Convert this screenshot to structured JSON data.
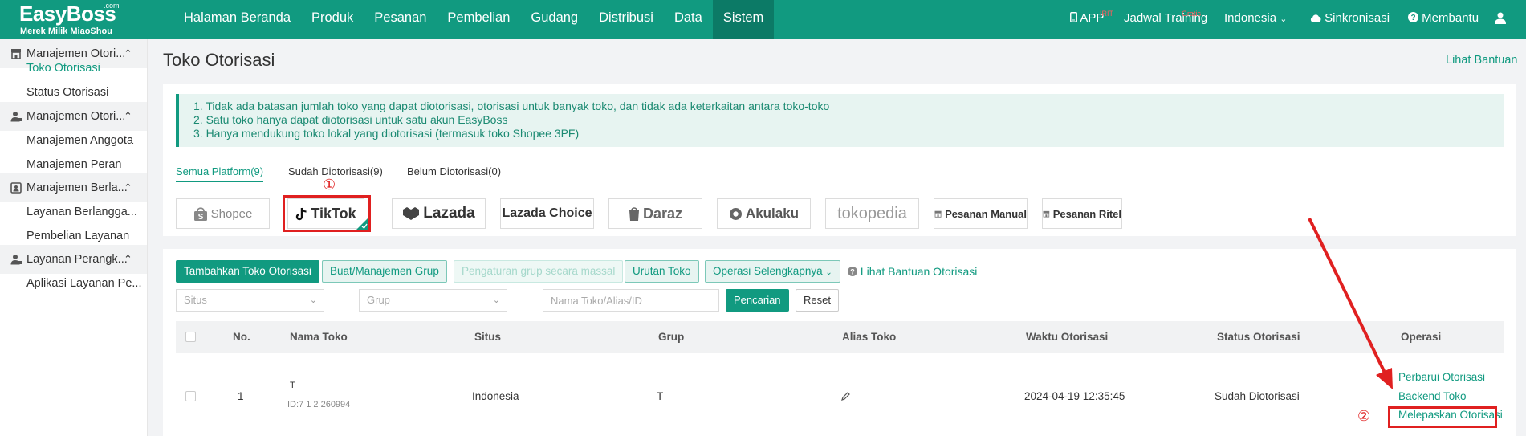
{
  "header": {
    "brand": "EasyBoss",
    "brand_suffix": ".com",
    "tagline": "Merek Milik MiaoShou",
    "nav": [
      "Halaman Beranda",
      "Produk",
      "Pesanan",
      "Pembelian",
      "Gudang",
      "Distribusi",
      "Data",
      "Sistem"
    ],
    "active_nav": "Sistem",
    "app_label": "APP",
    "app_badge": "IRIT",
    "training_label": "Jadwal Training",
    "training_badge": "Gratis",
    "language": "Indonesia",
    "sync_label": "Sinkronisasi",
    "help_label": "Membantu"
  },
  "sidebar": {
    "groups": [
      {
        "label": "Manajemen Otori...",
        "icon": "shop-icon",
        "items": [
          "Toko Otorisasi",
          "Status Otorisasi"
        ]
      },
      {
        "label": "Manajemen Otori...",
        "icon": "user-icon",
        "items": [
          "Manajemen Anggota",
          "Manajemen Peran"
        ]
      },
      {
        "label": "Manajemen Berla...",
        "icon": "contact-card-icon",
        "items": [
          "Layanan Berlangga...",
          "Pembelian Layanan"
        ]
      },
      {
        "label": "Layanan Perangk...",
        "icon": "user-icon",
        "items": [
          "Aplikasi Layanan Pe..."
        ]
      }
    ],
    "active_item": "Toko Otorisasi"
  },
  "page": {
    "title": "Toko Otorisasi",
    "help_link": "Lihat Bantuan",
    "notices": [
      "1. Tidak ada batasan jumlah toko yang dapat diotorisasi, otorisasi untuk banyak toko, dan tidak ada keterkaitan antara toko-toko",
      "2. Satu toko hanya dapat diotorisasi untuk satu akun EasyBoss",
      "3. Hanya mendukung toko lokal yang diotorisasi (termasuk toko Shopee 3PF)"
    ],
    "filter_tabs": [
      "Semua Platform(9)",
      "Sudah Diotorisasi(9)",
      "Belum Diotorisasi(0)"
    ],
    "active_filter_tab": "Semua Platform(9)",
    "platforms": [
      "Shopee",
      "TikTok",
      "Lazada",
      "Lazada Choice",
      "Daraz",
      "Akulaku",
      "tokopedia",
      "Pesanan Manual",
      "Pesanan Ritel"
    ],
    "selected_platform": "TikTok",
    "step1_marker": "①",
    "step2_marker": "②"
  },
  "toolbar": {
    "add_button": "Tambahkan Toko Otorisasi",
    "group_button": "Buat/Manajemen Grup",
    "bulk_group_button": "Pengaturan grup secara massal",
    "order_button": "Urutan Toko",
    "more_button": "Operasi Selengkapnya",
    "help_link": "Lihat Bantuan Otorisasi"
  },
  "filters": {
    "site_placeholder": "Situs",
    "group_placeholder": "Grup",
    "search_placeholder": "Nama Toko/Alias/ID",
    "search_button": "Pencarian",
    "reset_button": "Reset"
  },
  "table": {
    "columns": [
      "No.",
      "Nama Toko",
      "Situs",
      "Grup",
      "Alias Toko",
      "Waktu Otorisasi",
      "Status Otorisasi",
      "Operasi"
    ],
    "rows": [
      {
        "no": "1",
        "shop_name": "T",
        "shop_id": "ID:7 1 2 260994",
        "site": "Indonesia",
        "group": "T",
        "alias_icon": "edit-icon",
        "auth_time": "2024-04-19 12:35:45",
        "status": "Sudah Diotorisasi",
        "operations": [
          "Perbarui Otorisasi",
          "Backend Toko",
          "Melepaskan Otorisasi"
        ]
      }
    ]
  },
  "colors": {
    "brand": "#119a80",
    "annotation_red": "#e02020"
  }
}
